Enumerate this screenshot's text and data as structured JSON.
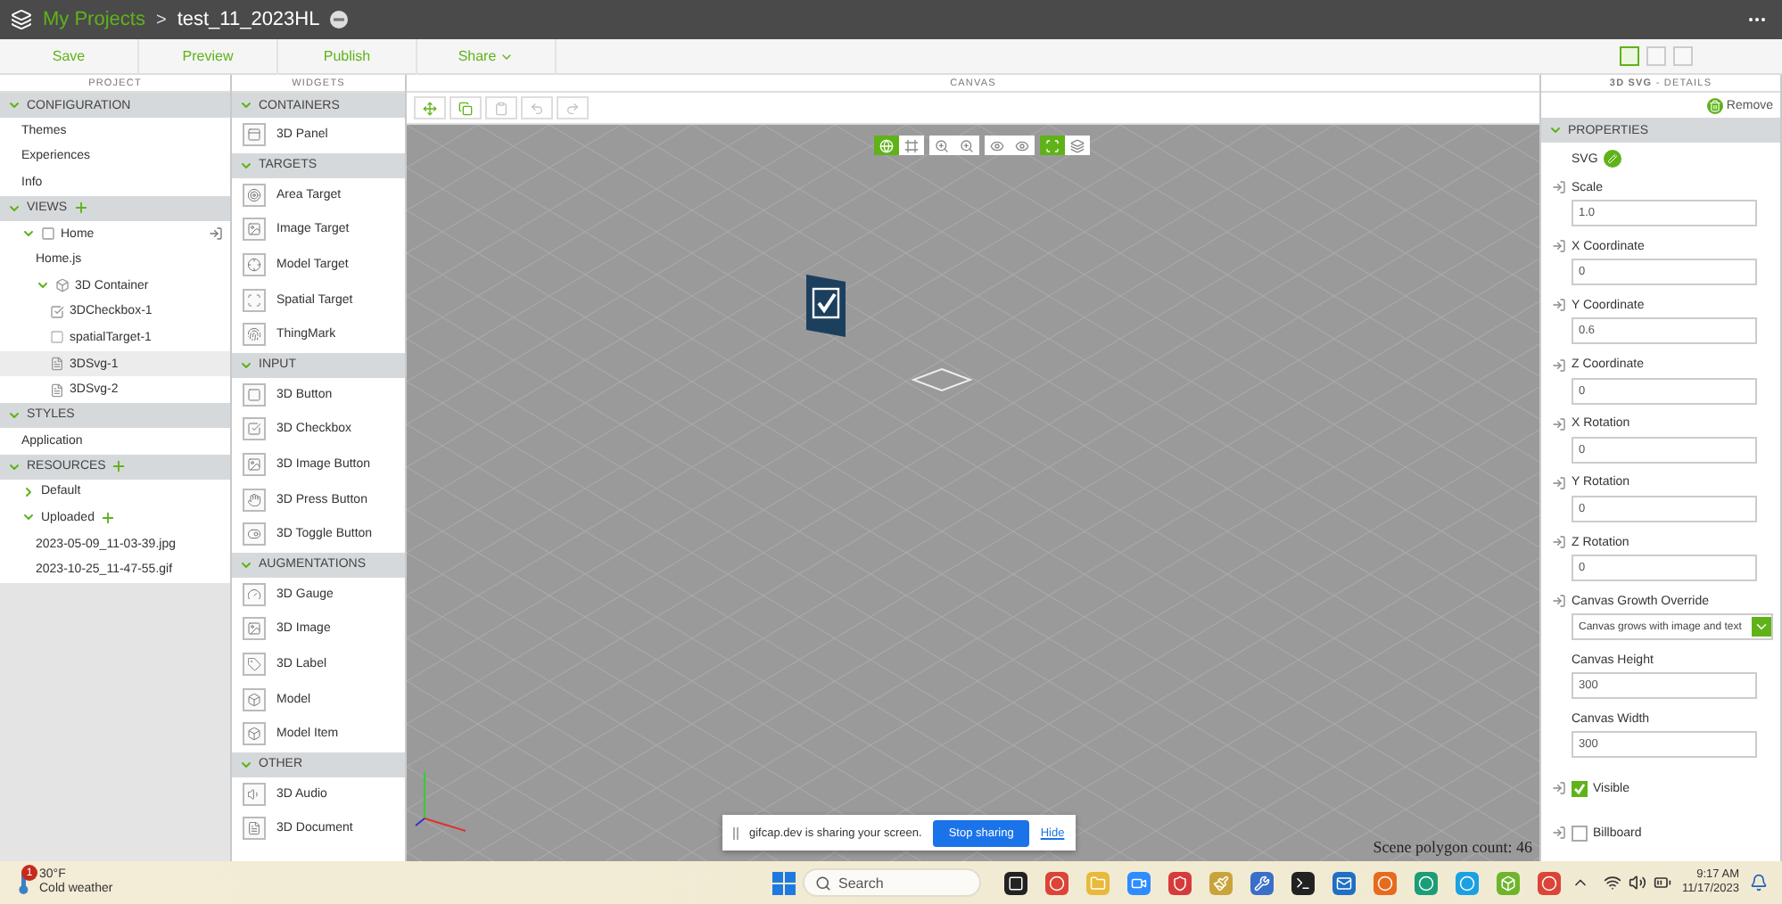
{
  "app_bar": {
    "breadcrumb": "My Projects",
    "separator": ">",
    "project_name": "test_11_2023HL"
  },
  "toolbar": {
    "actions": [
      {
        "label": "Save",
        "kind": "plain"
      },
      {
        "label": "Preview",
        "kind": "plain"
      },
      {
        "label": "Publish",
        "kind": "plain"
      },
      {
        "label": "Share",
        "kind": "menu"
      }
    ],
    "layout_buttons": [
      {
        "selected": true
      },
      {
        "selected": false
      },
      {
        "selected": false
      }
    ]
  },
  "project": {
    "title": "PROJECT",
    "sections": [
      {
        "label": "CONFIGURATION",
        "expanded": true,
        "addable": false,
        "children": [
          {
            "label": "Themes",
            "kind": "plain",
            "selected": false
          },
          {
            "label": "Experiences",
            "kind": "plain",
            "selected": false
          },
          {
            "label": "Info",
            "kind": "plain",
            "selected": false
          }
        ]
      },
      {
        "label": "VIEWS",
        "expanded": true,
        "addable": true,
        "children": [
          {
            "label": "Home",
            "kind": "view",
            "expanded": true,
            "selected": false,
            "children": [
              {
                "label": "Home.js",
                "kind": "plain",
                "selected": false
              },
              {
                "label": "3D Container",
                "kind": "container",
                "expanded": true,
                "selected": false,
                "children": [
                  {
                    "label": "3DCheckbox-1",
                    "kind": "checkbox",
                    "selected": false
                  },
                  {
                    "label": "spatialTarget-1",
                    "kind": "target",
                    "selected": false
                  },
                  {
                    "label": "3DSvg-1",
                    "kind": "svg",
                    "selected": true
                  },
                  {
                    "label": "3DSvg-2",
                    "kind": "svg",
                    "selected": false
                  }
                ]
              }
            ]
          }
        ]
      },
      {
        "label": "STYLES",
        "expanded": true,
        "addable": false,
        "children": [
          {
            "label": "Application",
            "kind": "plain",
            "selected": false
          }
        ]
      },
      {
        "label": "RESOURCES",
        "expanded": true,
        "addable": true,
        "children": [
          {
            "label": "Default",
            "kind": "folder",
            "expanded": false,
            "selected": false
          },
          {
            "label": "Uploaded",
            "kind": "folder",
            "expanded": true,
            "addable": true,
            "selected": false,
            "children": [
              {
                "label": "2023-05-09_11-03-39.jpg",
                "kind": "plain",
                "selected": false
              },
              {
                "label": "2023-10-25_11-47-55.gif",
                "kind": "plain",
                "selected": false
              }
            ]
          }
        ]
      }
    ]
  },
  "widgets": {
    "title": "WIDGETS",
    "sections": [
      {
        "label": "CONTAINERS",
        "expanded": true,
        "items": [
          {
            "label": "3D Panel",
            "kind": "panel"
          }
        ]
      },
      {
        "label": "TARGETS",
        "expanded": true,
        "items": [
          {
            "label": "Area Target",
            "kind": "area-target"
          },
          {
            "label": "Image Target",
            "kind": "image-target"
          },
          {
            "label": "Model Target",
            "kind": "model-target"
          },
          {
            "label": "Spatial Target",
            "kind": "spatial-target"
          },
          {
            "label": "ThingMark",
            "kind": "thingmark"
          }
        ]
      },
      {
        "label": "INPUT",
        "expanded": true,
        "items": [
          {
            "label": "3D Button",
            "kind": "button"
          },
          {
            "label": "3D Checkbox",
            "kind": "checkbox"
          },
          {
            "label": "3D Image Button",
            "kind": "image"
          },
          {
            "label": "3D Press Button",
            "kind": "press"
          },
          {
            "label": "3D Toggle Button",
            "kind": "toggle"
          }
        ]
      },
      {
        "label": "AUGMENTATIONS",
        "expanded": true,
        "items": [
          {
            "label": "3D Gauge",
            "kind": "gauge"
          },
          {
            "label": "3D Image",
            "kind": "image"
          },
          {
            "label": "3D Label",
            "kind": "label"
          },
          {
            "label": "Model",
            "kind": "model"
          },
          {
            "label": "Model Item",
            "kind": "model-item"
          }
        ]
      },
      {
        "label": "OTHER",
        "expanded": true,
        "items": [
          {
            "label": "3D Audio",
            "kind": "audio"
          },
          {
            "label": "3D Document",
            "kind": "document"
          }
        ]
      }
    ]
  },
  "canvas": {
    "title": "CANVAS",
    "tools": [
      {
        "kind": "add",
        "disabled": false
      },
      {
        "kind": "copy",
        "disabled": false
      },
      {
        "kind": "paste",
        "disabled": true
      },
      {
        "kind": "undo",
        "disabled": true
      },
      {
        "kind": "redo",
        "disabled": true
      }
    ],
    "view_toggles": [
      {
        "kind": "orbit",
        "selected": true
      },
      {
        "kind": "frame",
        "selected": false
      },
      {
        "kind": "zoom",
        "selected": false
      },
      {
        "kind": "zoom",
        "selected": false
      },
      {
        "kind": "eye",
        "selected": false
      },
      {
        "kind": "eye",
        "selected": false
      },
      {
        "kind": "target",
        "selected": true
      },
      {
        "kind": "layers",
        "selected": false
      }
    ],
    "share_notice": {
      "message": "gifcap.dev is sharing your screen.",
      "stop_button": "Stop sharing",
      "hide_link": "Hide"
    },
    "polygon_count": "Scene polygon count: 46"
  },
  "details": {
    "title": "**3D SVG** - DETAILS",
    "remove_button": "Remove",
    "section": {
      "label": "PROPERTIES",
      "expanded": true
    },
    "source_label": "SVG",
    "properties": [
      {
        "kind": "text",
        "label": "Scale",
        "value": "1.0",
        "bindable": true
      },
      {
        "kind": "text",
        "label": "X Coordinate",
        "value": "0",
        "bindable": true
      },
      {
        "kind": "text",
        "label": "Y Coordinate",
        "value": "0.6",
        "bindable": true
      },
      {
        "kind": "text",
        "label": "Z Coordinate",
        "value": "0",
        "bindable": true
      },
      {
        "kind": "text",
        "label": "X Rotation",
        "value": "0",
        "bindable": true
      },
      {
        "kind": "text",
        "label": "Y Rotation",
        "value": "0",
        "bindable": true
      },
      {
        "kind": "text",
        "label": "Z Rotation",
        "value": "0",
        "bindable": true
      },
      {
        "kind": "select",
        "label": "Canvas Growth Override",
        "value": "Canvas grows with image and text",
        "bindable": true
      },
      {
        "kind": "text",
        "label": "Canvas Height",
        "value": "300",
        "bindable": false
      },
      {
        "kind": "text",
        "label": "Canvas Width",
        "value": "300",
        "bindable": false
      },
      {
        "kind": "checkbox",
        "label": "Visible",
        "checked": true,
        "bindable": true
      },
      {
        "kind": "checkbox",
        "label": "Billboard",
        "checked": false,
        "bindable": true
      }
    ]
  },
  "taskbar": {
    "weather": {
      "badge": "1",
      "temperature": "30°F",
      "condition": "Cold weather"
    },
    "search_placeholder": "Search",
    "apps": [
      {
        "kind": "task-view"
      },
      {
        "kind": "browser"
      },
      {
        "kind": "folder"
      },
      {
        "kind": "video"
      },
      {
        "kind": "shield"
      },
      {
        "kind": "paint"
      },
      {
        "kind": "tool"
      },
      {
        "kind": "terminal"
      },
      {
        "kind": "mail"
      },
      {
        "kind": "firefox"
      },
      {
        "kind": "edge"
      },
      {
        "kind": "skype"
      },
      {
        "kind": "cube"
      },
      {
        "kind": "browser"
      }
    ],
    "clock": {
      "time": "9:17 AM",
      "date": "11/17/2023"
    }
  }
}
